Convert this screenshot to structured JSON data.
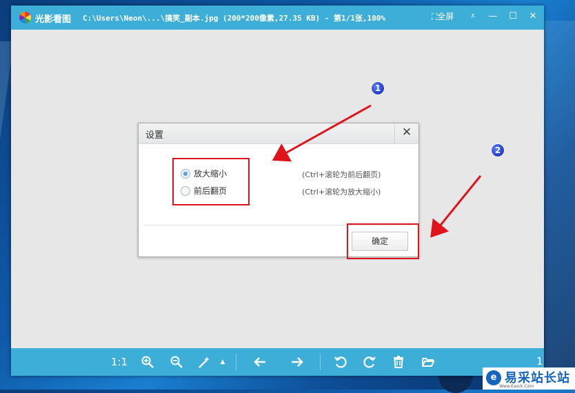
{
  "titlebar": {
    "app_name": "光影看图",
    "file_info": "C:\\Users\\Neon\\...\\搞笑_副本.jpg (200*200像素,27.35 KB) - 第1/1张,100%",
    "fullscreen_label": "全屏",
    "fullscreen_icon": "fullscreen-icon",
    "menu_icon": "menu-dropdown-icon",
    "minimize_icon": "minimize-icon",
    "maximize_icon": "maximize-icon",
    "close_icon": "close-icon"
  },
  "toolbar": {
    "actual_size_label": "1:1",
    "zoom_in_icon": "zoom-in-icon",
    "zoom_out_icon": "zoom-out-icon",
    "magic_icon": "magic-wand-icon",
    "prev_icon": "arrow-left-icon",
    "next_icon": "arrow-right-icon",
    "rotate_left_icon": "rotate-left-icon",
    "rotate_right_icon": "rotate-right-icon",
    "delete_icon": "trash-icon",
    "open_icon": "folder-open-icon",
    "page_number": "1"
  },
  "dialog": {
    "title": "设置",
    "options": [
      {
        "label": "放大缩小",
        "hint": "(Ctrl+滚轮为前后翻页)",
        "selected": true
      },
      {
        "label": "前后翻页",
        "hint": "(Ctrl+滚轮为放大缩小)",
        "selected": false
      }
    ],
    "ok_label": "确定"
  },
  "annotations": {
    "badge_1": "1",
    "badge_2": "2",
    "color": "#e0121a"
  },
  "watermark": {
    "name": "易采站长站",
    "url": "Www.Easck.Com"
  },
  "colors": {
    "titlebar": "#3daed8",
    "canvas": "#e7e7e7"
  }
}
